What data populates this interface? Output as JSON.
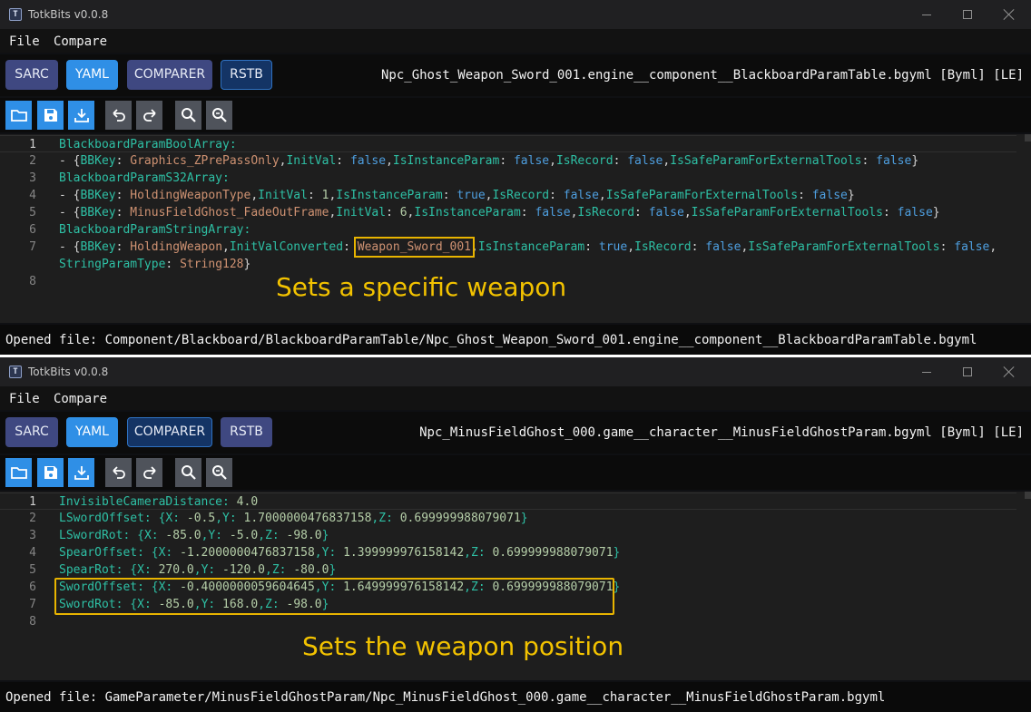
{
  "windows": [
    {
      "title": "TotkBits v0.0.8",
      "menu": {
        "file": "File",
        "compare": "Compare"
      },
      "tabs": {
        "sarc": "SARC",
        "yaml": "YAML",
        "comparer": "COMPARER",
        "rstb": "RSTB"
      },
      "file_title": "Npc_Ghost_Weapon_Sword_001.engine__component__BlackboardParamTable.bgyml [Byml] [LE]",
      "editor": {
        "line_numbers": [
          "1",
          "2",
          "3",
          "4",
          "5",
          "6",
          "7",
          "",
          "8"
        ],
        "lines": [
          "BlackboardParamBoolArray:",
          "  - {BBKey: Graphics_ZPrePassOnly,InitVal: false,IsInstanceParam: false,IsRecord: false,IsSafeParamForExternalTools: false}",
          "BlackboardParamS32Array:",
          "  - {BBKey: HoldingWeaponType,InitVal: 1,IsInstanceParam: true,IsRecord: false,IsSafeParamForExternalTools: false}",
          "  - {BBKey: MinusFieldGhost_FadeOutFrame,InitVal: 6,IsInstanceParam: false,IsRecord: false,IsSafeParamForExternalTools: false}",
          "BlackboardParamStringArray:",
          "  - {BBKey: HoldingWeapon,InitValConverted: Weapon_Sword_001,IsInstanceParam: true,IsRecord: false,IsSafeParamForExternalTools: false,",
          "    StringParamType: String128}",
          ""
        ]
      },
      "annotation": "Sets a specific weapon",
      "status": "Opened file: Component/Blackboard/BlackboardParamTable/Npc_Ghost_Weapon_Sword_001.engine__component__BlackboardParamTable.bgyml"
    },
    {
      "title": "TotkBits v0.0.8",
      "menu": {
        "file": "File",
        "compare": "Compare"
      },
      "tabs": {
        "sarc": "SARC",
        "yaml": "YAML",
        "comparer": "COMPARER",
        "rstb": "RSTB"
      },
      "file_title": "Npc_MinusFieldGhost_000.game__character__MinusFieldGhostParam.bgyml [Byml] [LE]",
      "editor": {
        "line_numbers": [
          "1",
          "2",
          "3",
          "4",
          "5",
          "6",
          "7",
          "8"
        ],
        "lines": [
          "InvisibleCameraDistance: 4.0",
          "LSwordOffset: {X: -0.5,Y: 1.7000000476837158,Z: 0.699999988079071}",
          "LSwordRot: {X: -85.0,Y: -5.0,Z: -98.0}",
          "SpearOffset: {X: -1.2000000476837158,Y: 1.399999976158142,Z: 0.699999988079071}",
          "SpearRot: {X: 270.0,Y: -120.0,Z: -80.0}",
          "SwordOffset: {X: -0.4000000059604645,Y: 1.649999976158142,Z: 0.699999988079071}",
          "SwordRot: {X: -85.0,Y: 168.0,Z: -98.0}",
          ""
        ]
      },
      "annotation": "Sets the weapon position",
      "status": "Opened file: GameParameter/MinusFieldGhostParam/Npc_MinusFieldGhost_000.game__character__MinusFieldGhostParam.bgyml"
    }
  ],
  "colors": {
    "key": "#2ec0a5",
    "string": "#cf9272",
    "boolean": "#4e9fe0",
    "number": "#b5cea8",
    "highlight_box": "#e8b400",
    "annotation": "#f2c200",
    "tab_active": "#2f8fe6",
    "tab_inactive": "#3f4881"
  },
  "icons": {
    "toolbar": [
      "folder-open-icon",
      "save-icon",
      "download-icon",
      "undo-icon",
      "redo-icon",
      "search-icon",
      "search-replace-icon"
    ]
  }
}
